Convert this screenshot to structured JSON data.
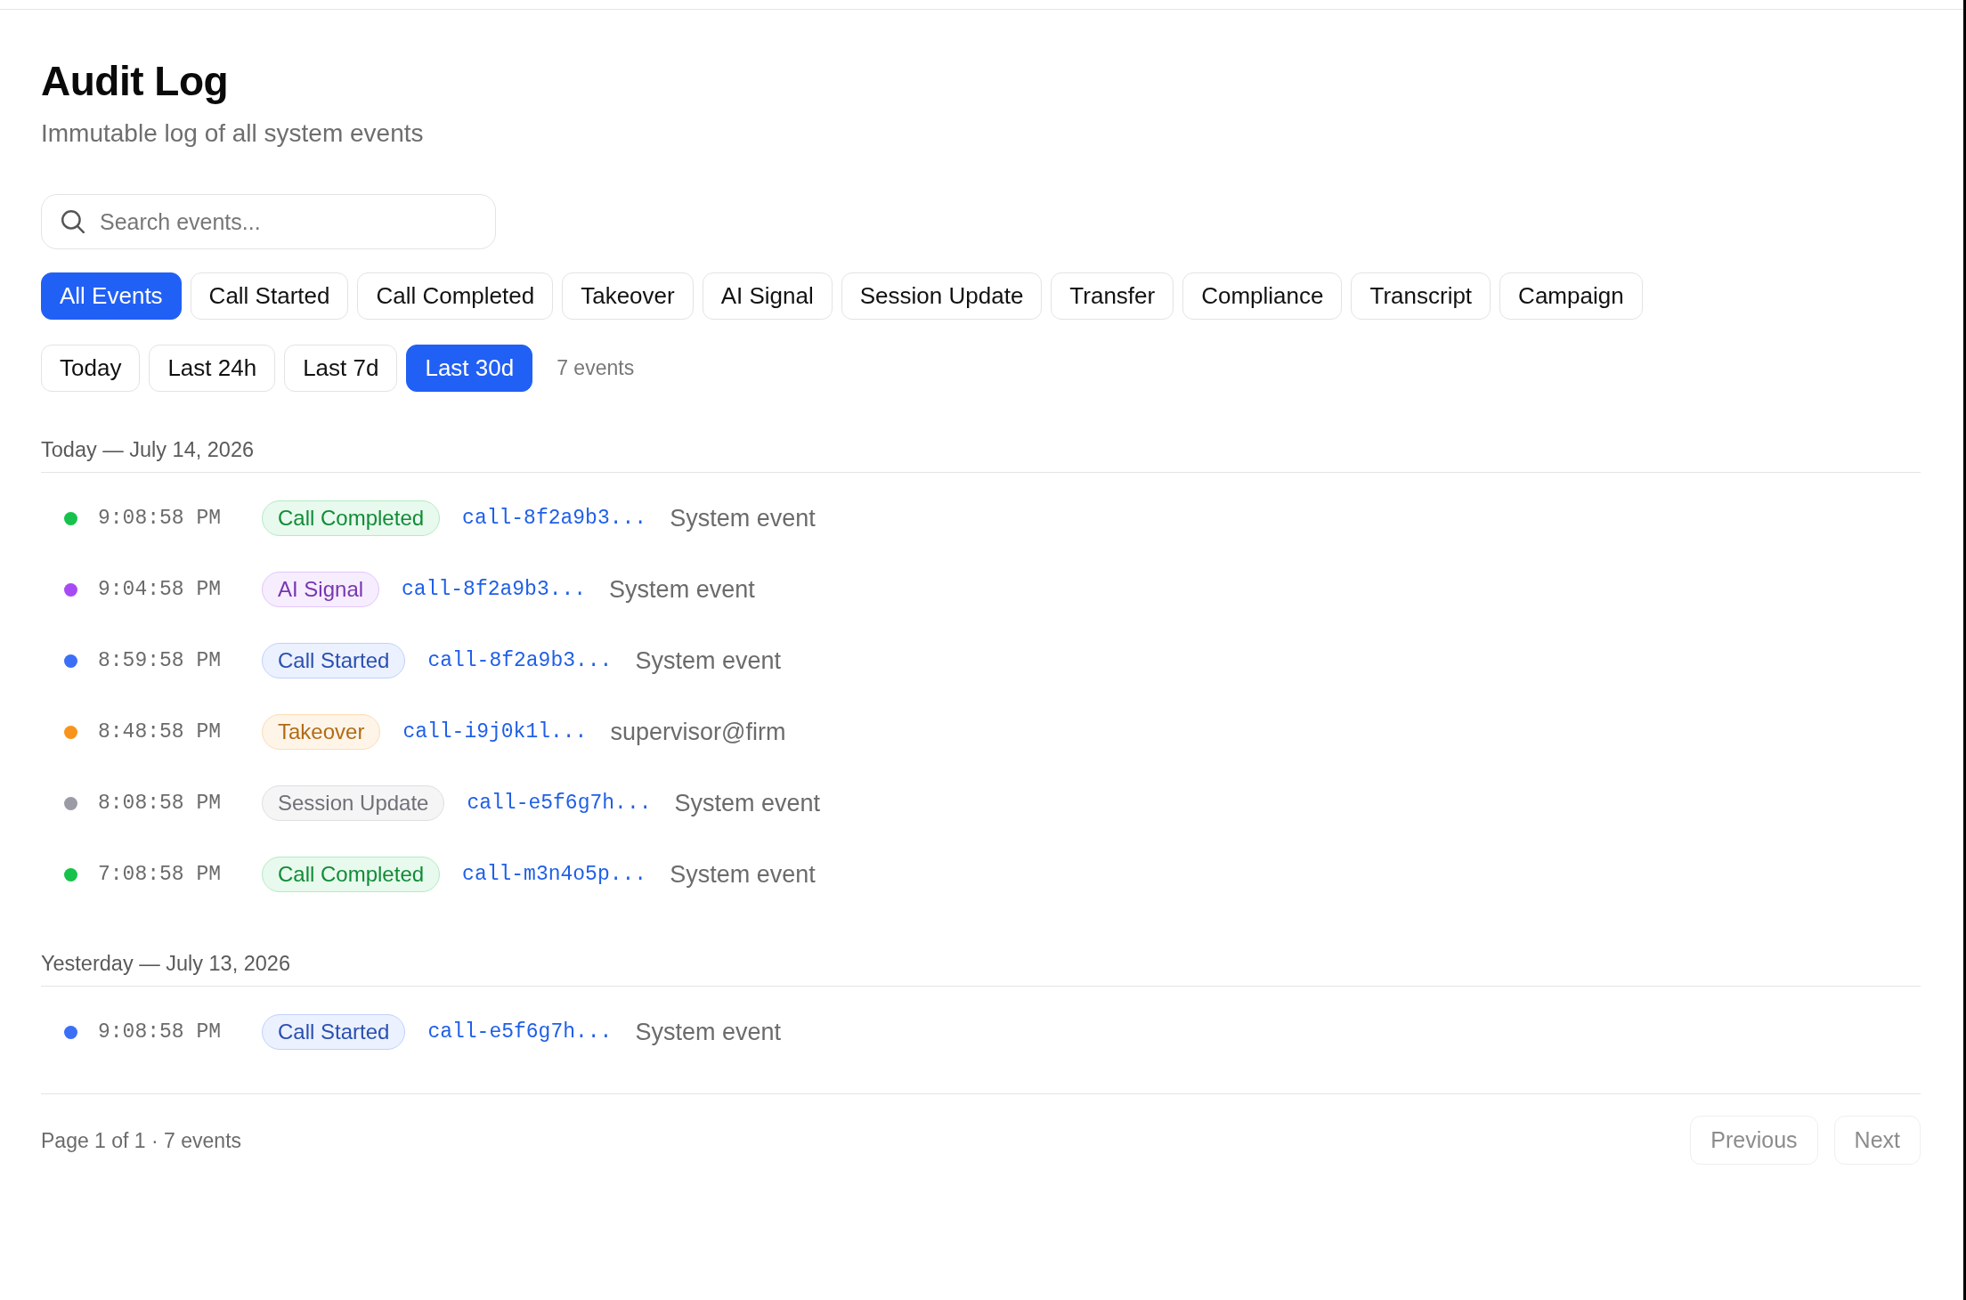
{
  "page": {
    "title": "Audit Log",
    "subtitle": "Immutable log of all system events"
  },
  "search": {
    "placeholder": "Search events..."
  },
  "event_filters": [
    {
      "label": "All Events",
      "selected": true
    },
    {
      "label": "Call Started",
      "selected": false
    },
    {
      "label": "Call Completed",
      "selected": false
    },
    {
      "label": "Takeover",
      "selected": false
    },
    {
      "label": "AI Signal",
      "selected": false
    },
    {
      "label": "Session Update",
      "selected": false
    },
    {
      "label": "Transfer",
      "selected": false
    },
    {
      "label": "Compliance",
      "selected": false
    },
    {
      "label": "Transcript",
      "selected": false
    },
    {
      "label": "Campaign",
      "selected": false
    }
  ],
  "time_ranges": [
    {
      "label": "Today",
      "selected": false
    },
    {
      "label": "Last 24h",
      "selected": false
    },
    {
      "label": "Last 7d",
      "selected": false
    },
    {
      "label": "Last 30d",
      "selected": true
    }
  ],
  "event_count": "7 events",
  "groups": [
    {
      "heading": "Today — July 14, 2026",
      "events": [
        {
          "color": "#16c24c",
          "time": "9:08:58 PM",
          "badge": "Call Completed",
          "call_id": "call-8f2a9b3...",
          "actor": "System event"
        },
        {
          "color": "#a64bf4",
          "time": "9:04:58 PM",
          "badge": "AI Signal",
          "call_id": "call-8f2a9b3...",
          "actor": "System event"
        },
        {
          "color": "#3b6ff5",
          "time": "8:59:58 PM",
          "badge": "Call Started",
          "call_id": "call-8f2a9b3...",
          "actor": "System event"
        },
        {
          "color": "#f7941d",
          "time": "8:48:58 PM",
          "badge": "Takeover",
          "call_id": "call-i9j0k1l...",
          "actor": "supervisor@firm"
        },
        {
          "color": "#9b9ba6",
          "time": "8:08:58 PM",
          "badge": "Session Update",
          "call_id": "call-e5f6g7h...",
          "actor": "System event"
        },
        {
          "color": "#16c24c",
          "time": "7:08:58 PM",
          "badge": "Call Completed",
          "call_id": "call-m3n4o5p...",
          "actor": "System event"
        }
      ]
    },
    {
      "heading": "Yesterday — July 13, 2026",
      "events": [
        {
          "color": "#3b6ff5",
          "time": "9:08:58 PM",
          "badge": "Call Started",
          "call_id": "call-e5f6g7h...",
          "actor": "System event"
        }
      ]
    }
  ],
  "pagination": {
    "summary": "Page 1 of 1 · 7 events",
    "buttons": [
      {
        "label": "Previous",
        "disabled": true
      },
      {
        "label": "Next",
        "disabled": true
      }
    ]
  }
}
